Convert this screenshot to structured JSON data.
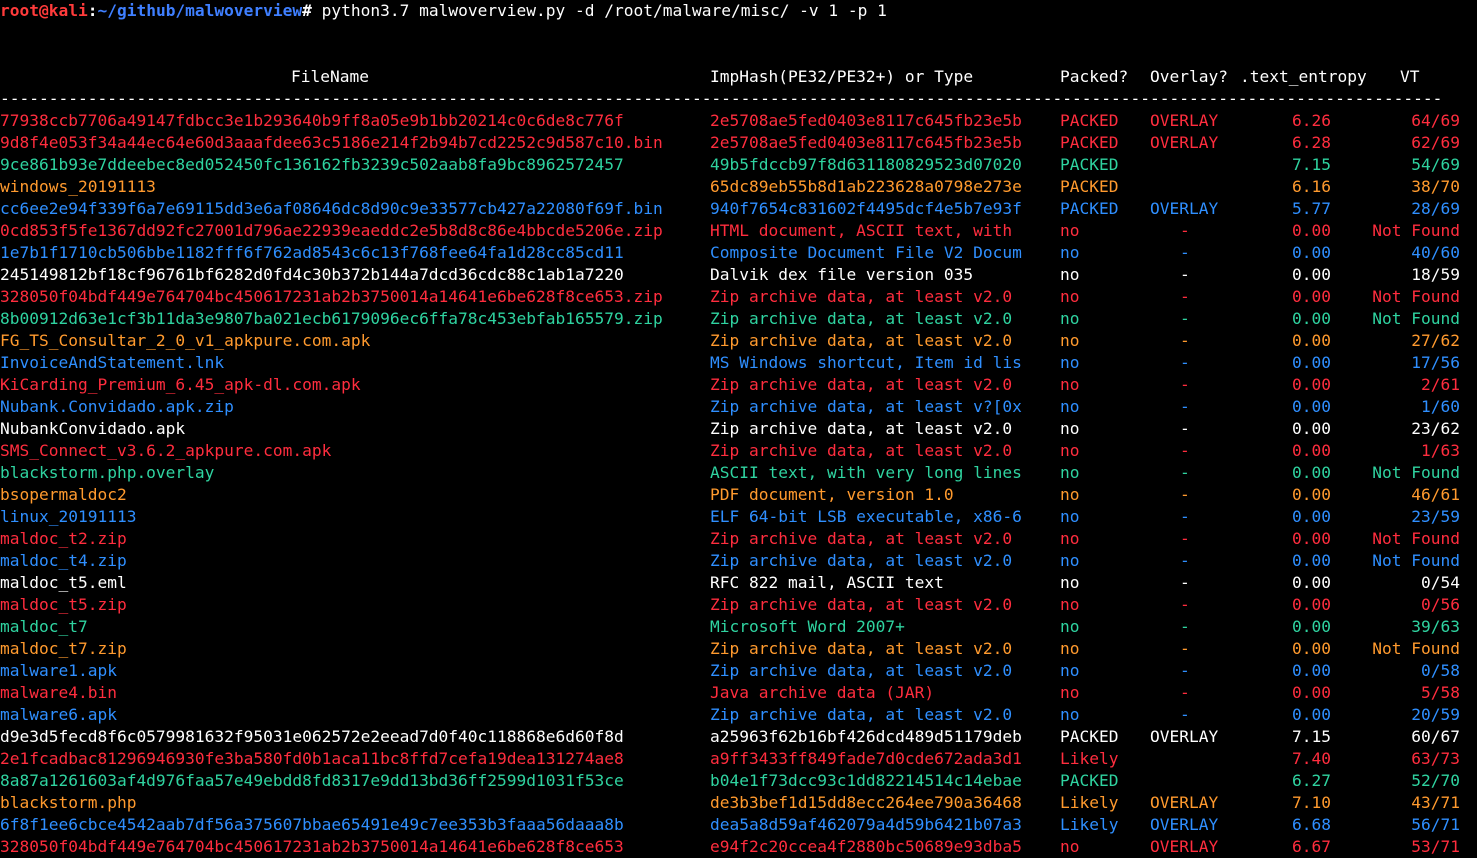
{
  "terminal": {
    "prompt_user": "root@kali",
    "prompt_sep": ":",
    "prompt_path": "~/github/malwoverview",
    "prompt_end": "# ",
    "command": "python3.7 malwoverview.py -d /root/malware/misc/ -v 1 -p 1"
  },
  "table": {
    "headers": {
      "filename": "FileName",
      "type": "ImpHash(PE32/PE32+) or Type",
      "packed": "Packed?",
      "overlay": "Overlay?",
      "entropy": ".text_entropy",
      "vt": "VT"
    },
    "separator": "-------------------------------------------------------------------------------------------------------------------------------------------------------------------------------------------------------------------------------------------------------------------------",
    "rows": [
      {
        "file": "77938ccb7706a49147fdbcc3e1b293640b9ff8a05e9b1bb20214c0c6de8c776f",
        "type": "2e5708ae5fed0403e8117c645fb23e5b",
        "packed": "PACKED",
        "overlay": "OVERLAY",
        "entropy": "6.26",
        "vt": "64/69",
        "color": "#ff2d3e"
      },
      {
        "file": "9d8f4e053f34a44ec64e60d3aaafdee63c5186e214f2b94b7cd2252c9d587c10.bin",
        "type": "2e5708ae5fed0403e8117c645fb23e5b",
        "packed": "PACKED",
        "overlay": "OVERLAY",
        "entropy": "6.28",
        "vt": "62/69",
        "color": "#ff2d3e"
      },
      {
        "file": "9ce861b93e7ddeebec8ed052450fc136162fb3239c502aab8fa9bc8962572457",
        "type": "49b5fdccb97f8d631180829523d07020",
        "packed": "PACKED",
        "overlay": "",
        "entropy": "7.15",
        "vt": "54/69",
        "color": "#2fd3a0"
      },
      {
        "file": "windows_20191113",
        "type": "65dc89eb55b8d1ab223628a0798e273e",
        "packed": "PACKED",
        "overlay": "",
        "entropy": "6.16",
        "vt": "38/70",
        "color": "#ff9a2e"
      },
      {
        "file": "cc6ee2e94f339f6a7e69115dd3e6af08646dc8d90c9e33577cb427a22080f69f.bin",
        "type": "940f7654c831602f4495dcf4e5b7e93f",
        "packed": "PACKED",
        "overlay": "OVERLAY",
        "entropy": "5.77",
        "vt": "28/69",
        "color": "#2f8fff"
      },
      {
        "file": "0cd853f5fe1367dd92fc27001d796ae22939eaeddc2e5b8d8c86e4bbcde5206e.zip",
        "type": "HTML document, ASCII text, with",
        "packed": "no",
        "overlay": "-",
        "entropy": "0.00",
        "vt": "Not Found",
        "color": "#ff2d3e"
      },
      {
        "file": "1e7b1f1710cb506bbe1182fff6f762ad8543c6c13f768fee64fa1d28cc85cd11",
        "type": "Composite Document File V2 Docum",
        "packed": "no",
        "overlay": "-",
        "entropy": "0.00",
        "vt": "40/60",
        "color": "#2f8fff"
      },
      {
        "file": "245149812bf18cf96761bf6282d0fd4c30b372b144a7dcd36cdc88c1ab1a7220",
        "type": "Dalvik dex file version 035",
        "packed": "no",
        "overlay": "-",
        "entropy": "0.00",
        "vt": "18/59",
        "color": "#ffffff"
      },
      {
        "file": "328050f04bdf449e764704bc450617231ab2b3750014a14641e6be628f8ce653.zip",
        "type": "Zip archive data, at least v2.0",
        "packed": "no",
        "overlay": "-",
        "entropy": "0.00",
        "vt": "Not Found",
        "color": "#ff2d3e"
      },
      {
        "file": "8b00912d63e1cf3b11da3e9807ba021ecb6179096ec6ffa78c453ebfab165579.zip",
        "type": "Zip archive data, at least v2.0",
        "packed": "no",
        "overlay": "-",
        "entropy": "0.00",
        "vt": "Not Found",
        "color": "#2fd3a0"
      },
      {
        "file": "FG_TS_Consultar_2_0_v1_apkpure.com.apk",
        "type": "Zip archive data, at least v2.0",
        "packed": "no",
        "overlay": "-",
        "entropy": "0.00",
        "vt": "27/62",
        "color": "#ff9a2e"
      },
      {
        "file": "InvoiceAndStatement.lnk",
        "type": "MS Windows shortcut, Item id lis",
        "packed": "no",
        "overlay": "-",
        "entropy": "0.00",
        "vt": "17/56",
        "color": "#2f8fff"
      },
      {
        "file": "KiCarding_Premium_6.45_apk-dl.com.apk",
        "type": "Zip archive data, at least v2.0",
        "packed": "no",
        "overlay": "-",
        "entropy": "0.00",
        "vt": "2/61",
        "color": "#ff2d3e"
      },
      {
        "file": "Nubank.Convidado.apk.zip",
        "type": "Zip archive data, at least v?[0x",
        "packed": "no",
        "overlay": "-",
        "entropy": "0.00",
        "vt": "1/60",
        "color": "#2f8fff"
      },
      {
        "file": "NubankConvidado.apk",
        "type": "Zip archive data, at least v2.0",
        "packed": "no",
        "overlay": "-",
        "entropy": "0.00",
        "vt": "23/62",
        "color": "#ffffff"
      },
      {
        "file": "SMS_Connect_v3.6.2_apkpure.com.apk",
        "type": "Zip archive data, at least v2.0",
        "packed": "no",
        "overlay": "-",
        "entropy": "0.00",
        "vt": "1/63",
        "color": "#ff2d3e"
      },
      {
        "file": "blackstorm.php.overlay",
        "type": "ASCII text, with very long lines",
        "packed": "no",
        "overlay": "-",
        "entropy": "0.00",
        "vt": "Not Found",
        "color": "#2fd3a0"
      },
      {
        "file": "bsopermaldoc2",
        "type": "PDF document, version 1.0",
        "packed": "no",
        "overlay": "-",
        "entropy": "0.00",
        "vt": "46/61",
        "color": "#ff9a2e"
      },
      {
        "file": "linux_20191113",
        "type": "ELF 64-bit LSB executable, x86-6",
        "packed": "no",
        "overlay": "-",
        "entropy": "0.00",
        "vt": "23/59",
        "color": "#2f8fff"
      },
      {
        "file": "maldoc_t2.zip",
        "type": "Zip archive data, at least v2.0",
        "packed": "no",
        "overlay": "-",
        "entropy": "0.00",
        "vt": "Not Found",
        "color": "#ff2d3e"
      },
      {
        "file": "maldoc_t4.zip",
        "type": "Zip archive data, at least v2.0",
        "packed": "no",
        "overlay": "-",
        "entropy": "0.00",
        "vt": "Not Found",
        "color": "#2f8fff"
      },
      {
        "file": "maldoc_t5.eml",
        "type": "RFC 822 mail, ASCII text",
        "packed": "no",
        "overlay": "-",
        "entropy": "0.00",
        "vt": "0/54",
        "color": "#ffffff"
      },
      {
        "file": "maldoc_t5.zip",
        "type": "Zip archive data, at least v2.0",
        "packed": "no",
        "overlay": "-",
        "entropy": "0.00",
        "vt": "0/56",
        "color": "#ff2d3e"
      },
      {
        "file": "maldoc_t7",
        "type": "Microsoft Word 2007+",
        "packed": "no",
        "overlay": "-",
        "entropy": "0.00",
        "vt": "39/63",
        "color": "#2fd3a0"
      },
      {
        "file": "maldoc_t7.zip",
        "type": "Zip archive data, at least v2.0",
        "packed": "no",
        "overlay": "-",
        "entropy": "0.00",
        "vt": "Not Found",
        "color": "#ff9a2e"
      },
      {
        "file": "malware1.apk",
        "type": "Zip archive data, at least v2.0",
        "packed": "no",
        "overlay": "-",
        "entropy": "0.00",
        "vt": "0/58",
        "color": "#2f8fff"
      },
      {
        "file": "malware4.bin",
        "type": "Java archive data (JAR)",
        "packed": "no",
        "overlay": "-",
        "entropy": "0.00",
        "vt": "5/58",
        "color": "#ff2d3e"
      },
      {
        "file": "malware6.apk",
        "type": "Zip archive data, at least v2.0",
        "packed": "no",
        "overlay": "-",
        "entropy": "0.00",
        "vt": "20/59",
        "color": "#2f8fff"
      },
      {
        "file": "d9e3d5fecd8f6c0579981632f95031e062572e2eead7d0f40c118868e6d60f8d",
        "type": "a25963f62b16bf426dcd489d51179deb",
        "packed": "PACKED",
        "overlay": "OVERLAY",
        "entropy": "7.15",
        "vt": "60/67",
        "color": "#ffffff"
      },
      {
        "file": "2e1fcadbac81296946930fe3ba580fd0b1aca11bc8ffd7cefa19dea131274ae8",
        "type": "a9ff3433ff849fade7d0cde672ada3d1",
        "packed": "Likely",
        "overlay": "",
        "entropy": "7.40",
        "vt": "63/73",
        "color": "#ff2d3e"
      },
      {
        "file": "8a87a1261603af4d976faa57e49ebdd8fd8317e9dd13bd36ff2599d1031f53ce",
        "type": "b04e1f73dcc93c1dd82214514c14ebae",
        "packed": "PACKED",
        "overlay": "",
        "entropy": "6.27",
        "vt": "52/70",
        "color": "#2fd3a0"
      },
      {
        "file": "blackstorm.php",
        "type": "de3b3bef1d15dd8ecc264ee790a36468",
        "packed": "Likely",
        "overlay": "OVERLAY",
        "entropy": "7.10",
        "vt": "43/71",
        "color": "#ff9a2e"
      },
      {
        "file": "6f8f1ee6cbce4542aab7df56a375607bbae65491e49c7ee353b3faaa56daaa8b",
        "type": "dea5a8d59af462079a4d59b6421b07a3",
        "packed": "Likely",
        "overlay": "OVERLAY",
        "entropy": "6.68",
        "vt": "56/71",
        "color": "#2f8fff"
      },
      {
        "file": "328050f04bdf449e764704bc450617231ab2b3750014a14641e6be628f8ce653",
        "type": "e94f2c20ccea4f2880bc50689e93dba5",
        "packed": "no",
        "overlay": "OVERLAY",
        "entropy": "6.67",
        "vt": "53/71",
        "color": "#ff2d3e"
      }
    ]
  }
}
